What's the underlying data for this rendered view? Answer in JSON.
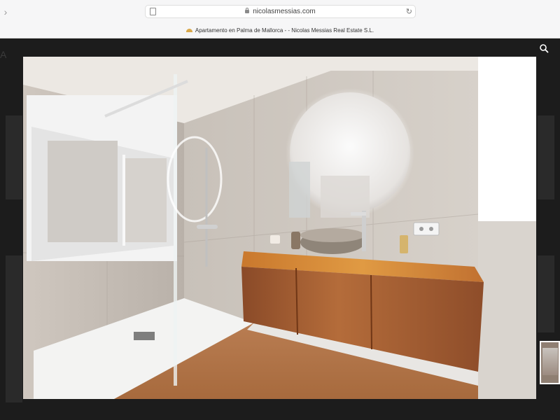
{
  "browser": {
    "url": "nicolasmessias.com",
    "tab_title": "Apartamento en Palma de Mallorca - - Nicolas Messias Real Estate S.L.",
    "icons": [
      "back-icon",
      "page-icon",
      "lock-icon",
      "reload-icon"
    ]
  },
  "site": {
    "search_icon": "search-icon",
    "background_color": "#1c1c1c"
  },
  "gallery": {
    "photo_subject": "modern bathroom with walk-in shower, round backlit mirror, wooden vanity and stone basin",
    "thumbnail_selected": true
  }
}
